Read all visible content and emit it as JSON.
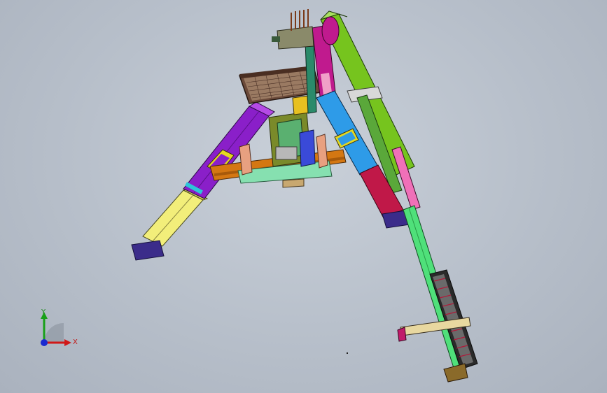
{
  "viewport": {
    "background": "#bcc3cd"
  },
  "model": {
    "name": "",
    "colors": {
      "purple_leg": "#8a1fc9",
      "yellow_leg": "#f2ee7a",
      "foot_navy": "#3b2c8a",
      "blue_leg": "#2e9be8",
      "crimson_leg": "#c01848",
      "green_arm": "#76c41e",
      "green_rod": "#4fe07a",
      "magenta_beam": "#c01a8e",
      "orange_bar": "#d47712",
      "mint_plate": "#86e0b0",
      "grid_panel": "#6b4a3a",
      "olive_base": "#7a8a2a"
    }
  },
  "triad": {
    "x_label": "X",
    "y_label": "Y",
    "x_color": "#d01818",
    "y_color": "#18a018",
    "z_color": "#1a2ad0"
  }
}
